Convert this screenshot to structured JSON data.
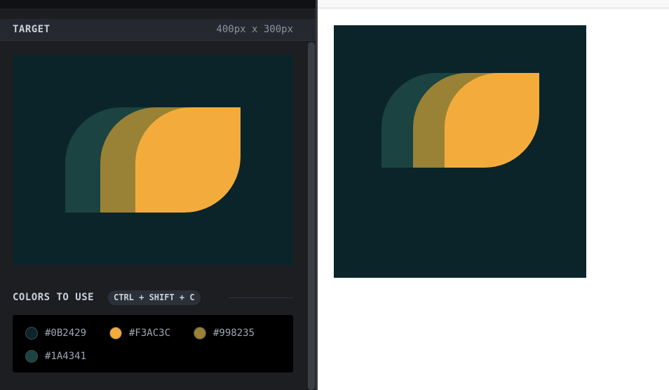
{
  "target": {
    "title": "TARGET",
    "dimensions": "400px x 300px"
  },
  "colors": {
    "title": "COLORS TO USE",
    "shortcut": "CTRL + SHIFT + C",
    "swatches": [
      {
        "hex": "#0B2429",
        "color": "#0B2429"
      },
      {
        "hex": "#F3AC3C",
        "color": "#F3AC3C"
      },
      {
        "hex": "#998235",
        "color": "#998235"
      },
      {
        "hex": "#1A4341",
        "color": "#1A4341"
      }
    ]
  },
  "palette": {
    "panel_bg": "#1d1e22",
    "header_bg": "#25282e",
    "canvas_bg": "#0B2429",
    "teal": "#1A4341",
    "olive": "#998235",
    "orange": "#F3AC3C"
  }
}
